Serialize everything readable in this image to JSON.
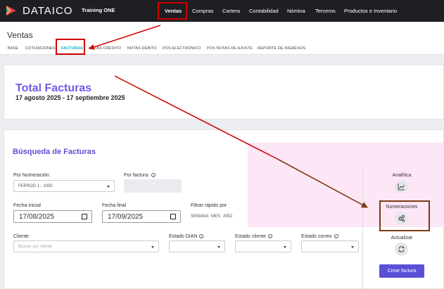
{
  "topbar": {
    "brand": "DATAICO",
    "company": "Training ONE",
    "nav": [
      "Ventas",
      "Compras",
      "Cartera",
      "Contabilidad",
      "Nómina",
      "Terceros",
      "Productos e Inventario"
    ]
  },
  "page": {
    "title": "Ventas",
    "subnav": [
      "BASE",
      "COTIZACIONES",
      "FACTURAS",
      "NOTAS CRÉDITO",
      "NOTAS DÉBITO",
      "POS ELECTRÓNICO",
      "POS NOTAS DE AJUSTE",
      "REPORTE DE INGRESOS"
    ]
  },
  "totals": {
    "title": "Total Facturas",
    "range": "17 agosto 2025 - 17 septiembre 2025"
  },
  "search": {
    "title": "Búsqueda de Facturas",
    "numeracion_label": "Por Numeración:",
    "numeracion_value": "FEPROD 1 - 1000",
    "factura_label": "Por factura:",
    "fecha_inicial_label": "Fecha inicial",
    "fecha_inicial_value": "17/08/2025",
    "fecha_final_label": "Fecha final",
    "fecha_final_value": "17/09/2025",
    "filtrar_label": "Filtrar rápido por",
    "quick_filters": [
      "SEMANA",
      "MES",
      "AÑO"
    ],
    "cliente_label": "Cliente",
    "cliente_placeholder": "Buscar por cliente",
    "estado_dian_label": "Estado DIAN",
    "estado_cliente_label": "Estado cliente",
    "estado_correo_label": "Estado correo"
  },
  "side": {
    "analitica": "Analítica",
    "numeraciones": "Numeraciones",
    "actualizar": "Actualizar",
    "crear": "Crear factura"
  },
  "colors": {
    "accent": "#5b4fd6",
    "title_purple": "#6c5ce7",
    "active_tab": "#1aa6b7",
    "annotation_red": "#d00000",
    "annotation_brown": "#7a3b13"
  }
}
